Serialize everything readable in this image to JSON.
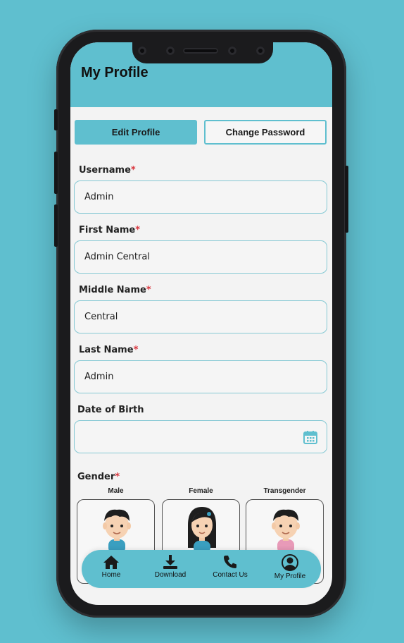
{
  "header": {
    "title": "My Profile"
  },
  "tabs": [
    {
      "label": "Edit Profile",
      "active": true
    },
    {
      "label": "Change Password",
      "active": false
    }
  ],
  "form": {
    "username": {
      "label": "Username",
      "required": "*",
      "value": "Admin"
    },
    "first_name": {
      "label": "First Name",
      "required": "*",
      "value": "Admin Central"
    },
    "middle_name": {
      "label": "Middle Name",
      "required": "*",
      "value": "Central"
    },
    "last_name": {
      "label": "Last Name",
      "required": "*",
      "value": "Admin"
    },
    "dob": {
      "label": "Date of Birth",
      "value": "",
      "icon": "calendar-icon"
    },
    "gender": {
      "label": "Gender",
      "required": "*",
      "options": [
        "Male",
        "Female",
        "Transgender"
      ]
    }
  },
  "bottom_nav": {
    "items": [
      {
        "label": "Home",
        "icon": "home-icon"
      },
      {
        "label": "Download",
        "icon": "download-icon"
      },
      {
        "label": "Contact Us",
        "icon": "phone-icon"
      },
      {
        "label": "My Profile",
        "icon": "profile-icon"
      }
    ]
  },
  "colors": {
    "accent": "#5fbfcf",
    "field_border": "#86c9d4",
    "required": "#d9363e"
  }
}
